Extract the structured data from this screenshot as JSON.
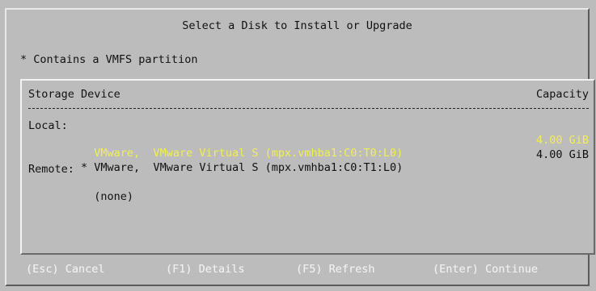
{
  "dialog": {
    "title": "Select a Disk to Install or Upgrade",
    "legend": "* Contains a VMFS partition"
  },
  "table": {
    "col_device": "Storage Device",
    "col_capacity": "Capacity",
    "local_label": "Local:",
    "remote_label": "Remote:",
    "local_disks": [
      {
        "text": "  VMware,  VMware Virtual S (mpx.vmhba1:C0:T0:L0)",
        "capacity": "4.00 GiB",
        "selected": true
      },
      {
        "text": "* VMware,  VMware Virtual S (mpx.vmhba1:C0:T1:L0)",
        "capacity": "4.00 GiB",
        "selected": false
      }
    ],
    "remote_disks": [
      {
        "text": "  (none)"
      }
    ]
  },
  "footer": {
    "cancel": "(Esc) Cancel",
    "details": "(F1) Details",
    "refresh": "(F5) Refresh",
    "continue": "(Enter) Continue"
  },
  "colors": {
    "background": "#bcbcbc",
    "selected_text": "#f2ee55",
    "footer_text": "#f0f0f0"
  }
}
